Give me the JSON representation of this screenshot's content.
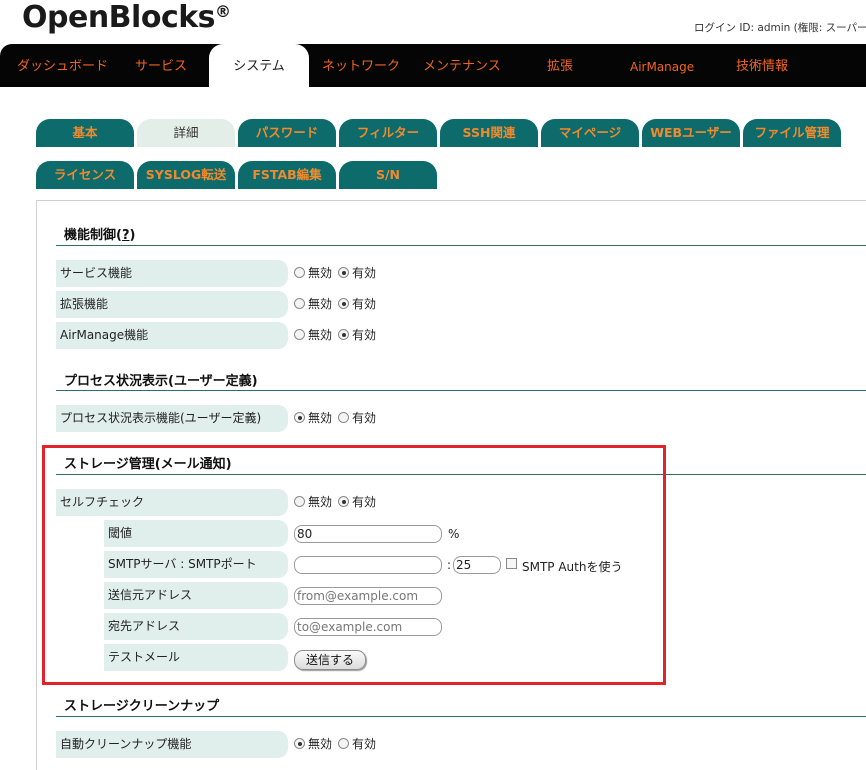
{
  "header": {
    "logo": "OpenBlocks",
    "logo_mark": "®",
    "login_info": "ログイン ID: admin (権限: スーパーユー"
  },
  "topnav": {
    "items": [
      {
        "label": "ダッシュボード"
      },
      {
        "label": "サービス"
      },
      {
        "label": "システム",
        "active": true
      },
      {
        "label": "ネットワーク"
      },
      {
        "label": "メンテナンス"
      },
      {
        "label": "拡張"
      },
      {
        "label": "AirManage"
      },
      {
        "label": "技術情報"
      }
    ]
  },
  "subtabs": {
    "row1": [
      {
        "label": "基本"
      },
      {
        "label": "詳細",
        "active": true
      },
      {
        "label": "パスワード"
      },
      {
        "label": "フィルター"
      },
      {
        "label": "SSH関連"
      },
      {
        "label": "マイページ"
      },
      {
        "label": "WEBユーザー"
      },
      {
        "label": "ファイル管理"
      }
    ],
    "row2": [
      {
        "label": "ライセンス"
      },
      {
        "label": "SYSLOG転送"
      },
      {
        "label": "FSTAB編集"
      },
      {
        "label": "S/N"
      }
    ]
  },
  "radio_labels": {
    "off": "無効",
    "on": "有効"
  },
  "sections": {
    "feature_control": {
      "title": "機能制御(",
      "help": "?",
      "title_end": ")",
      "rows": [
        {
          "label": "サービス機能",
          "value": "on"
        },
        {
          "label": "拡張機能",
          "value": "on"
        },
        {
          "label": "AirManage機能",
          "value": "on"
        }
      ]
    },
    "process_status": {
      "title": "プロセス状況表示(ユーザー定義)",
      "rows": [
        {
          "label": "プロセス状況表示機能(ユーザー定義)",
          "value": "off"
        }
      ]
    },
    "storage_mail": {
      "title": "ストレージ管理(メール通知)",
      "selfcheck": {
        "label": "セルフチェック",
        "value": "on"
      },
      "threshold": {
        "label": "閾値",
        "value": "80",
        "unit": "%"
      },
      "smtp": {
        "label": "SMTPサーバ : SMTPポート",
        "server_value": "",
        "separator": ":",
        "port_value": "25",
        "auth_label": "SMTP Authを使う",
        "auth_checked": false
      },
      "from": {
        "label": "送信元アドレス",
        "placeholder": "from@example.com"
      },
      "to": {
        "label": "宛先アドレス",
        "placeholder": "to@example.com"
      },
      "test_mail": {
        "label": "テストメール",
        "button": "送信する"
      }
    },
    "storage_cleanup": {
      "title": "ストレージクリーンナップ",
      "rows": [
        {
          "label": "自動クリーンナップ機能",
          "value": "off"
        }
      ]
    }
  },
  "colors": {
    "nav_bg": "#050505",
    "nav_text": "#f0641e",
    "tab_bg": "#0d6b6b",
    "tab_text": "#f08a2e",
    "label_bg": "#e0eeec",
    "highlight": "#e3232c"
  }
}
